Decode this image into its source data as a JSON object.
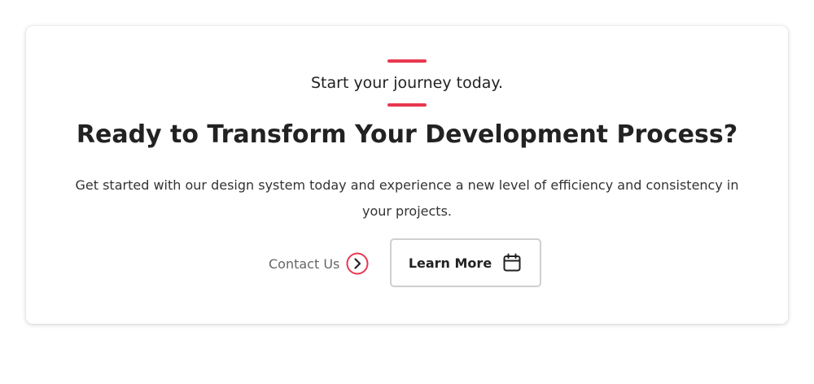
{
  "cta": {
    "eyebrow": "Start your journey today.",
    "headline": "Ready to Transform Your Development Process?",
    "description": "Get started with our design system today and experience a new level of efficiency and consistency in your projects.",
    "contact": {
      "label": "Contact Us",
      "icon": "chevron-right-circle-icon"
    },
    "learn_more": {
      "label": "Learn More",
      "icon": "calendar-icon"
    }
  },
  "colors": {
    "accent": "#e8384f",
    "text": "#222222",
    "muted_text": "#666666",
    "button_border": "#cfcfcf"
  }
}
